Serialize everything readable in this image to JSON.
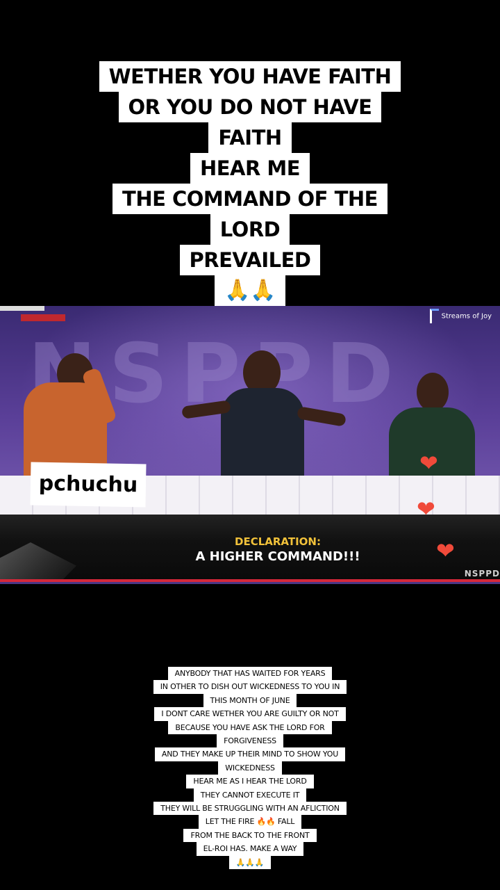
{
  "top_caption": {
    "lines": [
      "WETHER YOU HAVE FAITH",
      "OR YOU DO NOT HAVE",
      "FAITH",
      "HEAR ME",
      "THE COMMAND OF THE",
      "LORD",
      "PREVAILED",
      "🙏🙏"
    ]
  },
  "video": {
    "background_text": "NSPPD",
    "logo_text": "Streams of Joy",
    "lower_third": {
      "label": "DECLARATION:",
      "title": "A HIGHER COMMAND!!!",
      "corner": "NSPPD"
    }
  },
  "username": "pchuchu",
  "hearts": [
    "❤",
    "❤",
    "❤"
  ],
  "bottom_caption": {
    "lines": [
      "ANYBODY THAT HAS WAITED FOR YEARS",
      "IN OTHER TO DISH OUT WICKEDNESS TO YOU IN",
      "THIS MONTH OF JUNE",
      "I DONT CARE WETHER YOU ARE GUILTY OR NOT",
      "BECAUSE YOU HAVE ASK THE LORD FOR",
      "FORGIVENESS",
      "AND THEY MAKE UP THEIR MIND TO SHOW YOU",
      "WICKEDNESS",
      "HEAR ME AS I HEAR THE LORD",
      "THEY CANNOT EXECUTE IT",
      "THEY WILL BE STRUGGLING WITH AN AFLICTION",
      "LET THE FIRE 🔥🔥 FALL",
      "FROM THE BACK TO THE FRONT",
      "EL-ROI HAS. MAKE A WAY",
      "🙏🙏🙏"
    ]
  },
  "colors": {
    "caption_bg": "#ffffff",
    "stage_purple": "#5a3f98",
    "declaration_yellow": "#f2c23a",
    "accent_red": "#d6283a",
    "heart_red": "#f04a3a"
  }
}
